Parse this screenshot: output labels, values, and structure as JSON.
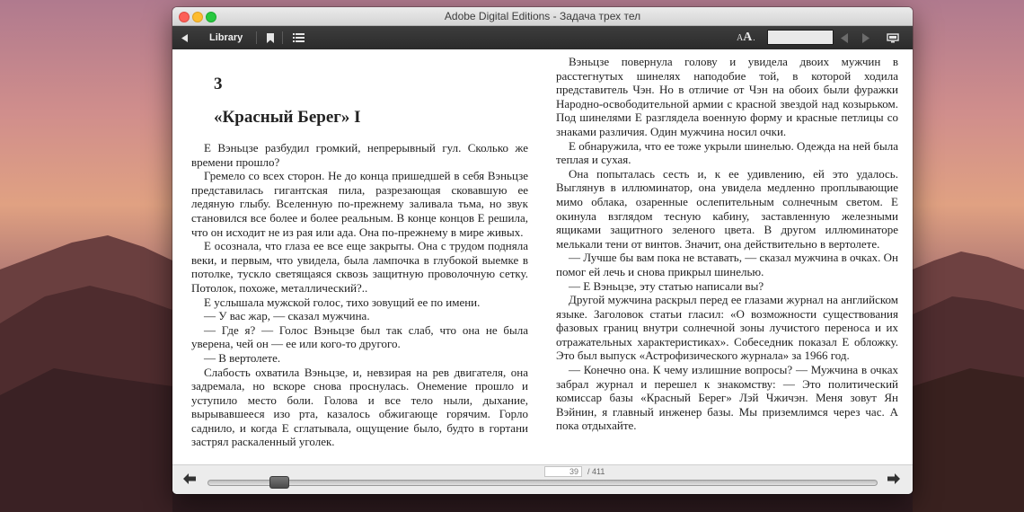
{
  "window": {
    "title": "Adobe Digital Editions - Задача трех тел"
  },
  "toolbar": {
    "back_icon": "back-triangle-icon",
    "library_label": "Library",
    "bookmark_icon": "bookmark-icon",
    "toc_icon": "list-icon",
    "font_size_icon": "text-size-icon",
    "font_a_small": "A",
    "font_a_large": "A",
    "font_dot": ".",
    "search_value": "",
    "search_placeholder": "",
    "prev_icon": "prev-arrow-icon",
    "next_icon": "next-arrow-icon",
    "display_icon": "display-mode-icon"
  },
  "book": {
    "chapter_number": "3",
    "chapter_title": "«Красный Берег» I",
    "left_paragraphs": [
      "Е Вэньцзе разбудил громкий, непрерывный гул. Сколько же времени прошло?",
      "Гремело со всех сторон. Не до конца пришедшей в себя Вэньцзе представилась гигантская пила, разрезающая сковавшую ее ледяную глыбу. Вселенную по-прежнему заливала тьма, но звук становился все более и более реальным. В конце концов Е решила, что он исходит не из рая или ада. Она по-прежнему в мире живых.",
      "Е осознала, что глаза ее все еще закрыты. Она с трудом подняла веки, и первым, что увидела, была лампочка в глубокой выемке в потолке, тускло светящаяся сквозь защитную проволочную сетку. Потолок, похоже, металлический?..",
      "Е услышала мужской голос, тихо зовущий ее по имени.",
      "— У вас жар, — сказал мужчина.",
      "— Где я? — Голос Вэньцзе был так слаб, что она не была уверена, чей он — ее или кого-то другого.",
      "— В вертолете.",
      "Слабость охватила Вэньцзе, и, невзирая на рев двигателя, она задремала, но вскоре снова проснулась. Онемение прошло и уступило место боли. Голова и все тело ныли, дыхание, вырывавшееся изо рта, казалось обжигающе горячим. Горло саднило, и когда Е сглатывала, ощущение было, будто в гортани застрял раскаленный уголек."
    ],
    "right_paragraphs": [
      "Вэньцзе повернула голову и увидела двоих мужчин в расстегнутых шинелях наподобие той, в которой ходила представитель Чэн. Но в отличие от Чэн на обоих были фуражки Народно-освободительной армии с красной звездой над козырьком. Под шинелями Е разглядела военную форму и красные петлицы со знаками различия. Один мужчина носил очки.",
      "Е обнаружила, что ее тоже укрыли шинелью. Одежда на ней была теплая и сухая.",
      "Она попыталась сесть и, к ее удивлению, ей это удалось. Выглянув в иллюминатор, она увидела медленно проплывающие мимо облака, озаренные ослепительным солнечным светом. Е окинула взглядом тесную кабину, заставленную железными ящиками защитного зеленого цвета. В другом иллюминаторе мелькали тени от винтов. Значит, она действительно в вертолете.",
      "— Лучше бы вам пока не вставать, — сказал мужчина в очках. Он помог ей лечь и снова прикрыл шинелью.",
      "— Е Вэньцзе, эту статью написали вы?",
      "Другой мужчина раскрыл перед ее глазами журнал на английском языке. Заголовок статьи гласил: «О возможности существования фазовых границ внутри солнечной зоны лучистого переноса и их отражательных характеристиках». Собеседник показал Е обложку. Это был выпуск «Астрофизического журнала» за 1966 год.",
      "— Конечно она. К чему излишние вопросы? — Мужчина в очках забрал журнал и перешел к знакомству: — Это политический комиссар базы «Красный Берег» Лэй Чжичэн. Меня зовут Ян Вэйнин, я главный инженер базы. Мы приземлимся через час. А пока отдыхайте."
    ]
  },
  "footer": {
    "prev_page_icon": "left-arrow-icon",
    "next_page_icon": "right-arrow-icon",
    "current_page": "39",
    "total_pages": "/ 411",
    "progress": 0.095
  }
}
